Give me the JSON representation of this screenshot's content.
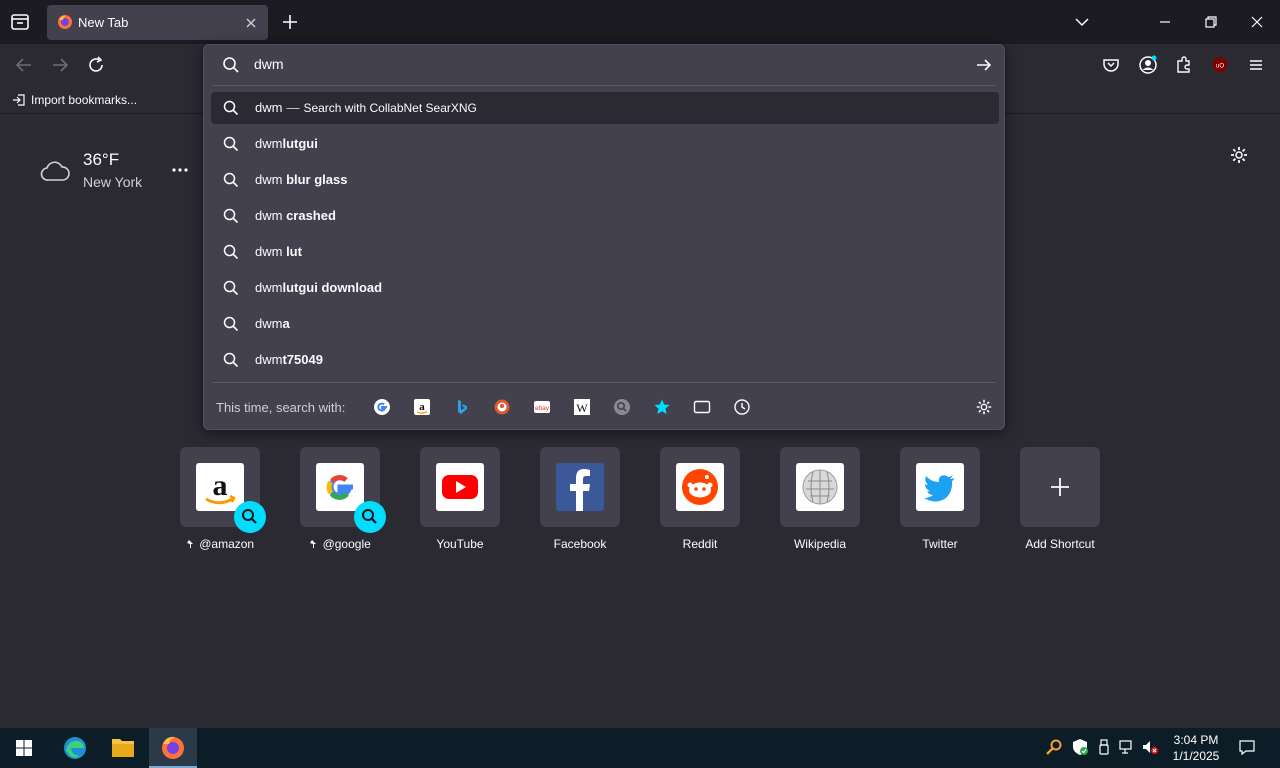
{
  "tab": {
    "title": "New Tab"
  },
  "bookmarks": {
    "import_label": "Import bookmarks..."
  },
  "weather": {
    "temp": "36°F",
    "location": "New York"
  },
  "urlbar": {
    "value": "dwm",
    "results": [
      {
        "typed": "dwm",
        "rest": "",
        "separator": "—",
        "action": "Search with CollabNet SearXNG",
        "selected": true
      },
      {
        "typed": "dwm",
        "rest": "lutgui"
      },
      {
        "typed": "dwm ",
        "rest": "blur glass"
      },
      {
        "typed": "dwm ",
        "rest": "crashed"
      },
      {
        "typed": "dwm ",
        "rest": "lut"
      },
      {
        "typed": "dwm",
        "rest": "lutgui download"
      },
      {
        "typed": "dwm",
        "rest": "a"
      },
      {
        "typed": "dwm",
        "rest": "t75049"
      }
    ],
    "oneoff_label": "This time, search with:",
    "oneoff_engines": [
      "google",
      "amazon",
      "bing",
      "duckduckgo",
      "ebay",
      "wikipedia",
      "searxng",
      "bookmarks",
      "tabs",
      "history"
    ]
  },
  "shortcuts": [
    {
      "label": "@amazon",
      "pinned": true,
      "search": true,
      "icon": "amazon"
    },
    {
      "label": "@google",
      "pinned": true,
      "search": true,
      "icon": "google"
    },
    {
      "label": "YouTube",
      "icon": "youtube"
    },
    {
      "label": "Facebook",
      "icon": "facebook"
    },
    {
      "label": "Reddit",
      "icon": "reddit"
    },
    {
      "label": "Wikipedia",
      "icon": "wikipedia"
    },
    {
      "label": "Twitter",
      "icon": "twitter"
    },
    {
      "label": "Add Shortcut",
      "icon": "plus"
    }
  ],
  "taskbar": {
    "time": "3:04 PM",
    "date": "1/1/2025"
  },
  "colors": {
    "accent": "#00ddff",
    "bg": "#2b2a33",
    "panel": "#42414d",
    "chrome": "#1c1b22",
    "taskbar": "#0d1d28"
  }
}
